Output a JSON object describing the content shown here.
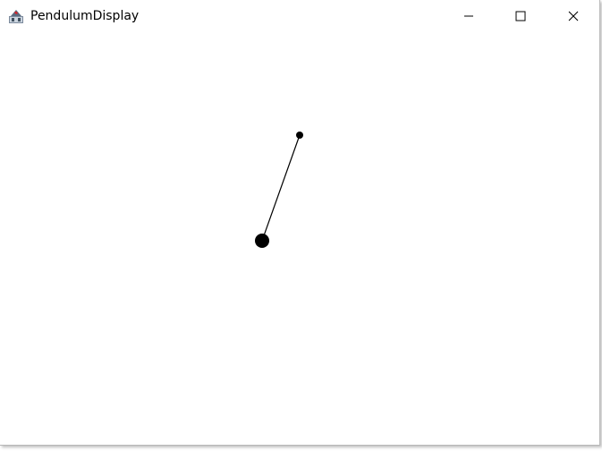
{
  "window": {
    "title": "PendulumDisplay",
    "app_icon": "java-app-icon"
  },
  "titlebar_buttons": {
    "minimize_icon": "minimize-icon",
    "maximize_icon": "maximize-icon",
    "close_icon": "close-icon"
  },
  "pendulum": {
    "rod_color": "#000000",
    "bob_color": "#000000",
    "pivot_color": "#000000"
  }
}
